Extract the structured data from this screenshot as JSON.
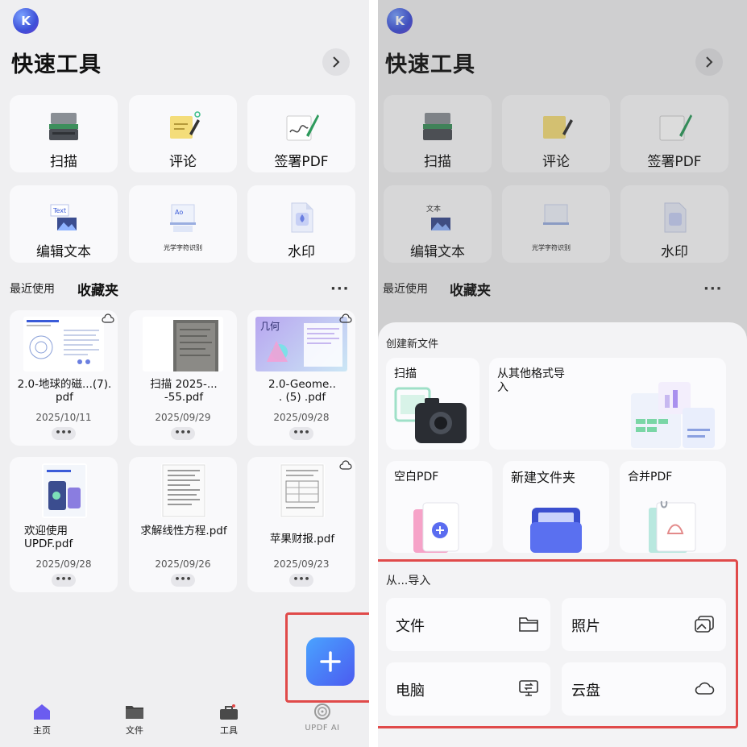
{
  "left": {
    "avatar_letter": "K",
    "title": "快速工具",
    "tools": [
      {
        "label": "扫描",
        "icon": "scanner-icon"
      },
      {
        "label": "评论",
        "icon": "comment-note-icon"
      },
      {
        "label": "签署PDF",
        "icon": "sign-pen-icon"
      },
      {
        "label": "编辑文本",
        "icon": "edit-text-icon",
        "thumb_text": "Text"
      },
      {
        "label": "光学字符识别",
        "icon": "ocr-icon",
        "thumb_text": "Ao"
      },
      {
        "label": "水印",
        "icon": "watermark-icon"
      }
    ],
    "tabs": {
      "recent": "最近使用",
      "favorites": "收藏夹",
      "more": "···"
    },
    "files": [
      {
        "name": "2.0-地球的磁...(7).\npdf",
        "date": "2025/10/11",
        "cloud": true,
        "thumb": "doc-diagram"
      },
      {
        "name": "扫描 2025-...\n-55.pdf",
        "date": "2025/09/29",
        "cloud": false,
        "thumb": "photo-page"
      },
      {
        "name": "2.0-Geome..\n. (5) .pdf",
        "date": "2025/09/28",
        "cloud": true,
        "thumb": "geometry",
        "thumb_text": "几何"
      },
      {
        "name": "欢迎使用\nUPDF.pdf",
        "date": "2025/09/28",
        "cloud": false,
        "thumb": "welcome"
      },
      {
        "name": "求解线性方程.pdf",
        "date": "2025/09/26",
        "cloud": false,
        "thumb": "doc-text"
      },
      {
        "name": "苹果财报.pdf",
        "date": "2025/09/23",
        "cloud": true,
        "thumb": "doc-text"
      }
    ],
    "card_more": "•••",
    "nav": [
      {
        "label": "主页",
        "icon": "home-icon"
      },
      {
        "label": "文件",
        "icon": "folder-icon"
      },
      {
        "label": "工具",
        "icon": "toolbox-icon"
      },
      {
        "label": "UPDF AI",
        "icon": "ai-swirl-icon"
      }
    ],
    "colors": {
      "accent": "#4b5bf0",
      "highlight": "#e04a4a"
    }
  },
  "right": {
    "avatar_letter": "K",
    "title": "快速工具",
    "tools": [
      "扫描",
      "评论",
      "签署PDF",
      "编辑文本",
      "光学字符识别",
      "水印"
    ],
    "tool_thumb_text": "文本",
    "tabs": {
      "recent": "最近使用",
      "favorites": "收藏夹",
      "more": "···"
    },
    "sheet": {
      "create_heading": "创建新文件",
      "create": [
        {
          "label": "扫描",
          "icon": "camera-icon"
        },
        {
          "label": "从其他格式导\n入",
          "icon": "import-formats-icon"
        },
        {
          "label": "空白PDF",
          "icon": "blank-pdf-icon"
        },
        {
          "label": "新建文件夹",
          "icon": "new-folder-icon"
        },
        {
          "label": "合并PDF",
          "icon": "merge-pdf-icon"
        }
      ],
      "import_heading": "从...导入",
      "import": [
        {
          "label": "文件",
          "icon": "folder-outline-icon"
        },
        {
          "label": "照片",
          "icon": "photos-icon"
        },
        {
          "label": "电脑",
          "icon": "computer-icon"
        },
        {
          "label": "云盘",
          "icon": "cloud-icon"
        }
      ]
    }
  }
}
